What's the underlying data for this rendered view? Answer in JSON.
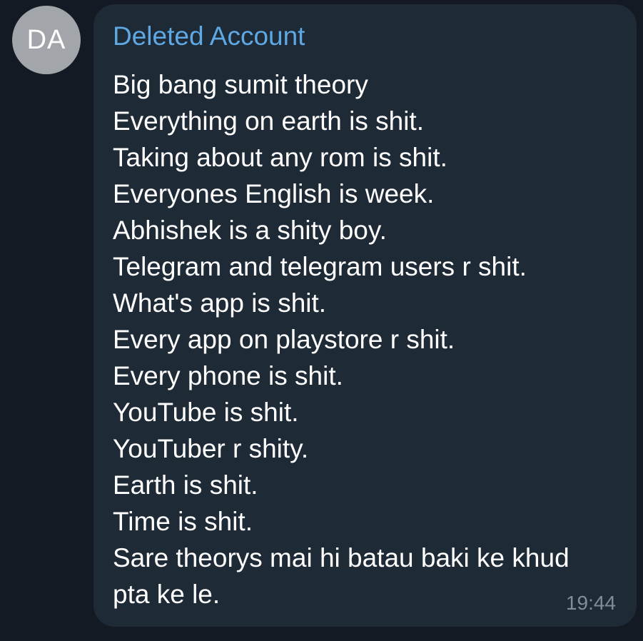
{
  "sender": {
    "initials": "DA",
    "name": "Deleted Account"
  },
  "message": {
    "lines": [
      "Big bang sumit theory",
      "Everything on earth is shit.",
      "Taking about any rom is shit.",
      "Everyones English is week.",
      "Abhishek is a shity boy.",
      "Telegram and telegram users r shit.",
      "What's app is shit.",
      "Every app on playstore r shit.",
      "Every phone is shit.",
      "YouTube is shit.",
      "YouTuber r shity.",
      "Earth is shit.",
      "Time is shit.",
      "Sare theorys mai hi batau baki ke khud",
      "pta ke le."
    ],
    "time": "19:44"
  },
  "colors": {
    "background": "#131a24",
    "bubble": "#1f2a37",
    "avatar": "#a2a5a9",
    "sender_name": "#5ea8e4",
    "message_text": "#ffffff",
    "timestamp": "#7f8d9c"
  }
}
